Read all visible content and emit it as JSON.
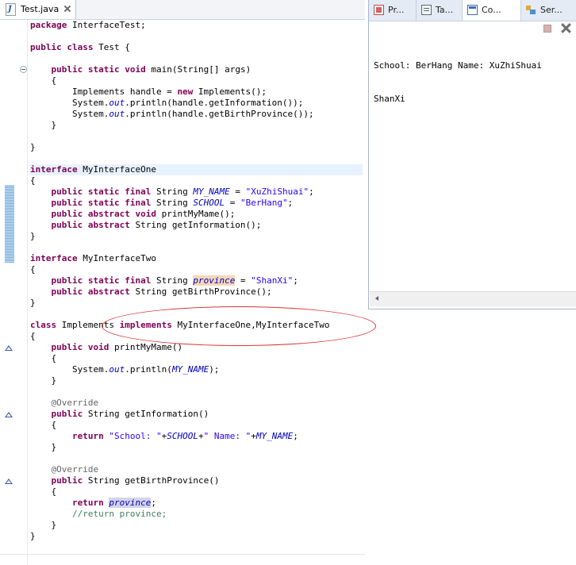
{
  "editor": {
    "tab": {
      "label": "Test.java",
      "file_icon_letter": "J"
    },
    "code": [
      {
        "t": "package InterfaceTest;",
        "s": []
      },
      {
        "t": "",
        "s": []
      },
      {
        "t": "public class Test {",
        "s": []
      },
      {
        "t": "",
        "s": []
      },
      {
        "t": "    public static void main(String[] args)",
        "s": []
      },
      {
        "t": "    {",
        "s": []
      },
      {
        "t": "        Implements handle = new Implements();",
        "s": []
      },
      {
        "t": "        System.out.println(handle.getInformation());",
        "s": []
      },
      {
        "t": "        System.out.println(handle.getBirthProvince());",
        "s": []
      },
      {
        "t": "    }",
        "s": []
      },
      {
        "t": "",
        "s": []
      },
      {
        "t": "}",
        "s": []
      },
      {
        "t": "",
        "s": []
      },
      {
        "t": "interface MyInterfaceOne",
        "s": []
      },
      {
        "t": "{",
        "s": []
      },
      {
        "t": "    public static final String MY_NAME = \"XuZhiShuai\";",
        "s": []
      },
      {
        "t": "    public static final String SCHOOL = \"BerHang\";",
        "s": []
      },
      {
        "t": "    public abstract void printMyMame();",
        "s": []
      },
      {
        "t": "    public abstract String getInformation();",
        "s": []
      },
      {
        "t": "}",
        "s": []
      },
      {
        "t": "",
        "s": []
      },
      {
        "t": "interface MyInterfaceTwo",
        "s": []
      },
      {
        "t": "{",
        "s": []
      },
      {
        "t": "    public static final String province = \"ShanXi\";",
        "s": []
      },
      {
        "t": "    public abstract String getBirthProvince();",
        "s": []
      },
      {
        "t": "}",
        "s": []
      },
      {
        "t": "",
        "s": []
      },
      {
        "t": "class Implements implements MyInterfaceOne,MyInterfaceTwo",
        "s": []
      },
      {
        "t": "{",
        "s": []
      },
      {
        "t": "    public void printMyMame()",
        "s": []
      },
      {
        "t": "    {",
        "s": []
      },
      {
        "t": "        System.out.println(MY_NAME);",
        "s": []
      },
      {
        "t": "    }",
        "s": []
      },
      {
        "t": "",
        "s": []
      },
      {
        "t": "    @Override",
        "s": []
      },
      {
        "t": "    public String getInformation()",
        "s": []
      },
      {
        "t": "    {",
        "s": []
      },
      {
        "t": "        return \"School: \"+SCHOOL+\" Name: \"+MY_NAME;",
        "s": []
      },
      {
        "t": "    }",
        "s": []
      },
      {
        "t": "",
        "s": []
      },
      {
        "t": "    @Override",
        "s": []
      },
      {
        "t": "    public String getBirthProvince()",
        "s": []
      },
      {
        "t": "    {",
        "s": []
      },
      {
        "t": "        return province;",
        "s": []
      },
      {
        "t": "        //return province;",
        "s": []
      },
      {
        "t": "    }",
        "s": []
      },
      {
        "t": "}",
        "s": []
      }
    ]
  },
  "console": {
    "tabs": [
      {
        "label": "Pr...",
        "icon": "problems-icon"
      },
      {
        "label": "Ta...",
        "icon": "tasks-icon"
      },
      {
        "label": "Co...",
        "icon": "console-icon",
        "active": true
      },
      {
        "label": "Ser...",
        "icon": "servers-icon"
      }
    ],
    "output": [
      "School: BerHang Name: XuZhiShuai",
      "ShanXi"
    ]
  },
  "colors": {
    "keyword": "#7f0055",
    "string": "#2a00ff",
    "static_field": "#0000c0",
    "comment": "#3f7f5f",
    "annotation_red": "#d93535"
  }
}
